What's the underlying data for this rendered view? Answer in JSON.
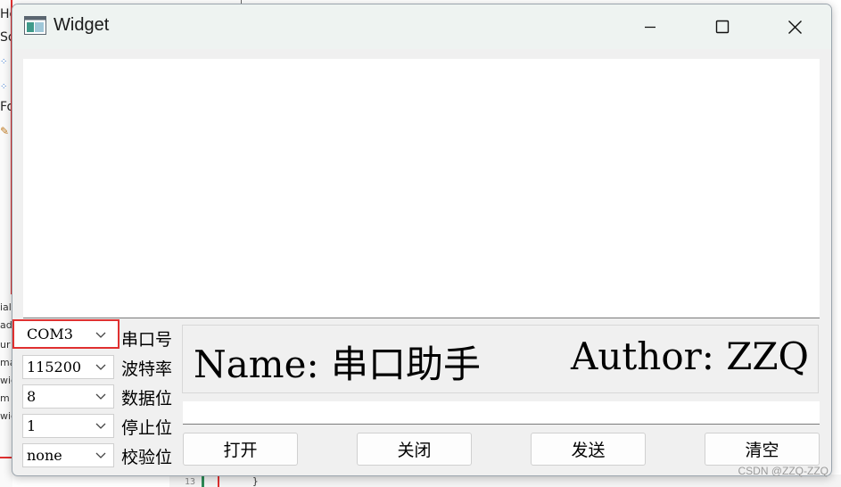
{
  "background": {
    "left_fragments": [
      "He",
      "So",
      "Fo",
      "ial.",
      "ad",
      "ur",
      "ma",
      "wid",
      "m",
      "wid"
    ],
    "line_number": "13",
    "brace": "}"
  },
  "window": {
    "title": "Widget",
    "app_icon": "window-app-icon",
    "controls": [
      "minimize-icon",
      "maximize-icon",
      "close-icon"
    ]
  },
  "settings": [
    {
      "value": "COM3",
      "label": "串口号"
    },
    {
      "value": "115200",
      "label": "波特率"
    },
    {
      "value": "8",
      "label": "数据位"
    },
    {
      "value": "1",
      "label": "停止位"
    },
    {
      "value": "none",
      "label": "校验位"
    }
  ],
  "banner": {
    "name": "Name: 串口助手",
    "author": "Author: ZZQ"
  },
  "buttons": {
    "open": "打开",
    "close": "关闭",
    "send": "发送",
    "clear": "清空"
  },
  "watermark": "CSDN @ZZQ-ZZQ",
  "colors": {
    "highlight": "#e03030",
    "window_bg": "#f0f0f0",
    "titlebar_bg": "#eef3f1"
  }
}
